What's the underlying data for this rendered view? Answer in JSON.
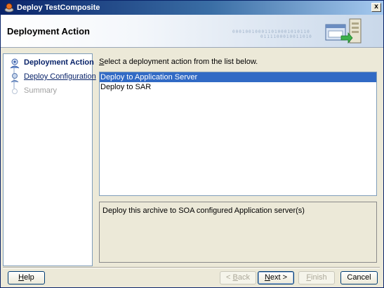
{
  "window": {
    "title": "Deploy TestComposite",
    "close": "x"
  },
  "header": {
    "title": "Deployment Action",
    "binary_line1": "000100100011010001010110",
    "binary_line2": "0111100010011010"
  },
  "nav": {
    "items": [
      {
        "label": "Deployment Action",
        "state": "active"
      },
      {
        "label": "Deploy Configuration",
        "state": "link"
      },
      {
        "label": "Summary",
        "state": "disabled"
      }
    ]
  },
  "content": {
    "instruction_mnemonic": "S",
    "instruction_rest": "elect a deployment action from the list below.",
    "actions": [
      {
        "label": "Deploy to Application Server",
        "selected": true
      },
      {
        "label": "Deploy to SAR",
        "selected": false
      }
    ],
    "description": "Deploy this archive to SOA configured Application server(s)"
  },
  "buttons": {
    "help_mn": "H",
    "help_rest": "elp",
    "back_pre": "< ",
    "back_mn": "B",
    "back_rest": "ack",
    "next_mn": "N",
    "next_rest": "ext >",
    "finish_mn": "F",
    "finish_rest": "inish",
    "cancel": "Cancel"
  },
  "colors": {
    "title_bar": "#0a246a",
    "selection": "#316ac5",
    "active_step": "#0a246a"
  }
}
